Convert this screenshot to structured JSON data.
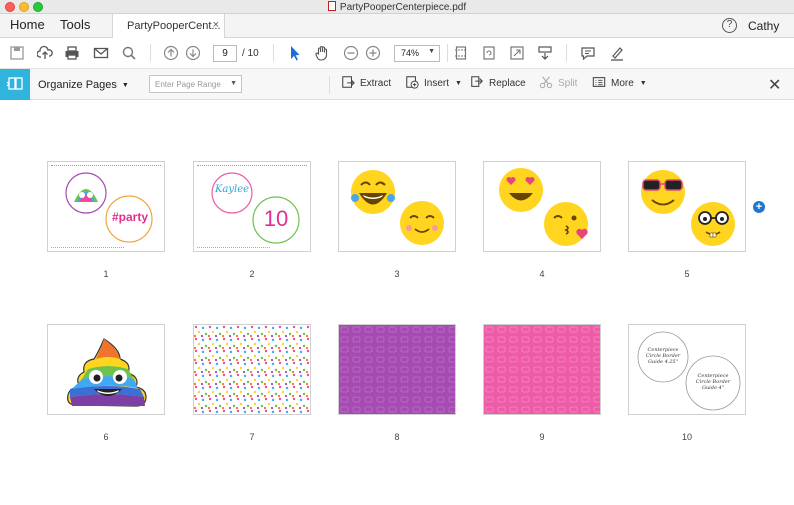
{
  "window": {
    "title": "PartyPooperCenterpiece.pdf"
  },
  "tabs": {
    "home": "Home",
    "tools": "Tools",
    "document": "PartyPooperCent...",
    "close": "×"
  },
  "account": {
    "help": "?",
    "user": "Cathy"
  },
  "toolbar": {
    "icons": [
      "save-icon",
      "upload-icon",
      "print-icon",
      "email-icon",
      "search-icon",
      "page-up-icon",
      "page-down-icon",
      "select-arrow-icon",
      "hand-icon",
      "zoom-out-icon",
      "zoom-in-icon",
      "zoom-value",
      "fit-page-icon",
      "rotate-view-icon",
      "full-screen-icon",
      "scroll-mode-icon",
      "comment-icon",
      "highlight-icon"
    ],
    "current_page": "9",
    "total_pages": "/ 10",
    "zoom": "74%"
  },
  "organize": {
    "title": "Organize Pages",
    "range_placeholder": "Enter Page Range",
    "extract": "Extract",
    "insert": "Insert",
    "replace": "Replace",
    "split": "Split",
    "more": "More"
  },
  "pages": [
    {
      "number": "1",
      "texts": [
        "#party"
      ]
    },
    {
      "number": "2",
      "texts": [
        "Kaylee",
        "10"
      ]
    },
    {
      "number": "3"
    },
    {
      "number": "4"
    },
    {
      "number": "5"
    },
    {
      "number": "6"
    },
    {
      "number": "7"
    },
    {
      "number": "8"
    },
    {
      "number": "9"
    },
    {
      "number": "10",
      "texts": [
        "Centerpiece Circle Border Guide 4.25\"",
        "Centerpiece Circle Border Guide 4\""
      ]
    }
  ],
  "colors": {
    "accent": "#2fb5dd",
    "purple": "#a54bb1",
    "pink": "#ee5ba7",
    "emoji": "#ffd51f"
  }
}
